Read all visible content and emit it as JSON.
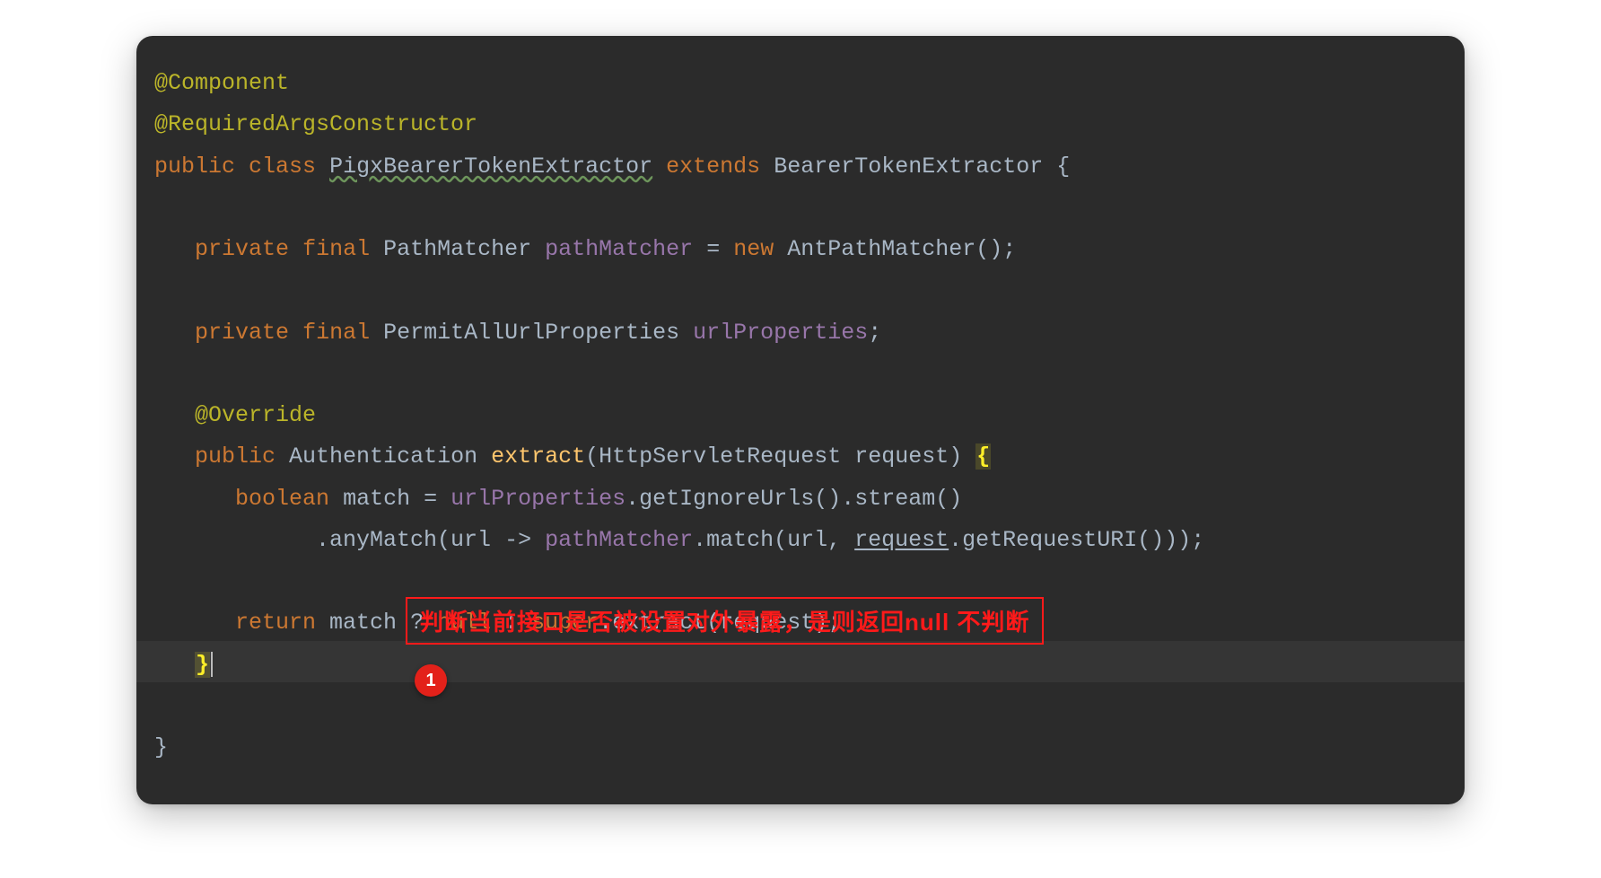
{
  "colors": {
    "background": "#2b2b2b",
    "default_text": "#a9b7c6",
    "annotation": "#bbb529",
    "keyword": "#cc7832",
    "method": "#ffc66d",
    "field": "#9876aa",
    "brace_highlight": "#ffef28",
    "callout_red": "#ff1a1a",
    "badge_red": "#e3211a"
  },
  "code": {
    "line1": {
      "annotation": "@Component"
    },
    "line2": {
      "annotation": "@RequiredArgsConstructor"
    },
    "line3": {
      "kw_public": "public",
      "kw_class": "class",
      "class_name": "PigxBearerTokenExtractor",
      "kw_extends": "extends",
      "super_name": "BearerTokenExtractor",
      "brace": "{"
    },
    "line5": {
      "kw_private": "private",
      "kw_final": "final",
      "type": "PathMatcher",
      "field": "pathMatcher",
      "eq": "=",
      "kw_new": "new",
      "ctor": "AntPathMatcher",
      "tail": "();"
    },
    "line7": {
      "kw_private": "private",
      "kw_final": "final",
      "type": "PermitAllUrlProperties",
      "field": "urlProperties",
      "semi": ";"
    },
    "line9": {
      "annotation": "@Override"
    },
    "line10": {
      "kw_public": "public",
      "ret_type": "Authentication",
      "method": "extract",
      "param_type": "HttpServletRequest",
      "param_name": "request",
      "brace": "{"
    },
    "line11": {
      "kw_boolean": "boolean",
      "var": "match",
      "eq": "=",
      "field": "urlProperties",
      "call1": ".getIgnoreUrls().stream()"
    },
    "line12": {
      "call_prefix": ".anyMatch(url -> ",
      "field": "pathMatcher",
      "call_mid": ".match(url, ",
      "request": "request",
      "call_tail": ".getRequestURI()));"
    },
    "line14": {
      "kw_return": "return",
      "var": "match",
      "q": "?",
      "null": "null",
      "colon": ":",
      "kw_super": "super",
      "call": ".extract(request);"
    },
    "line15": {
      "brace_close": "}"
    },
    "line17": {
      "brace_close": "}"
    }
  },
  "callout": {
    "text": "判断当前接口是否被设置对外暴露，是则返回null 不判断",
    "badge": "1"
  }
}
